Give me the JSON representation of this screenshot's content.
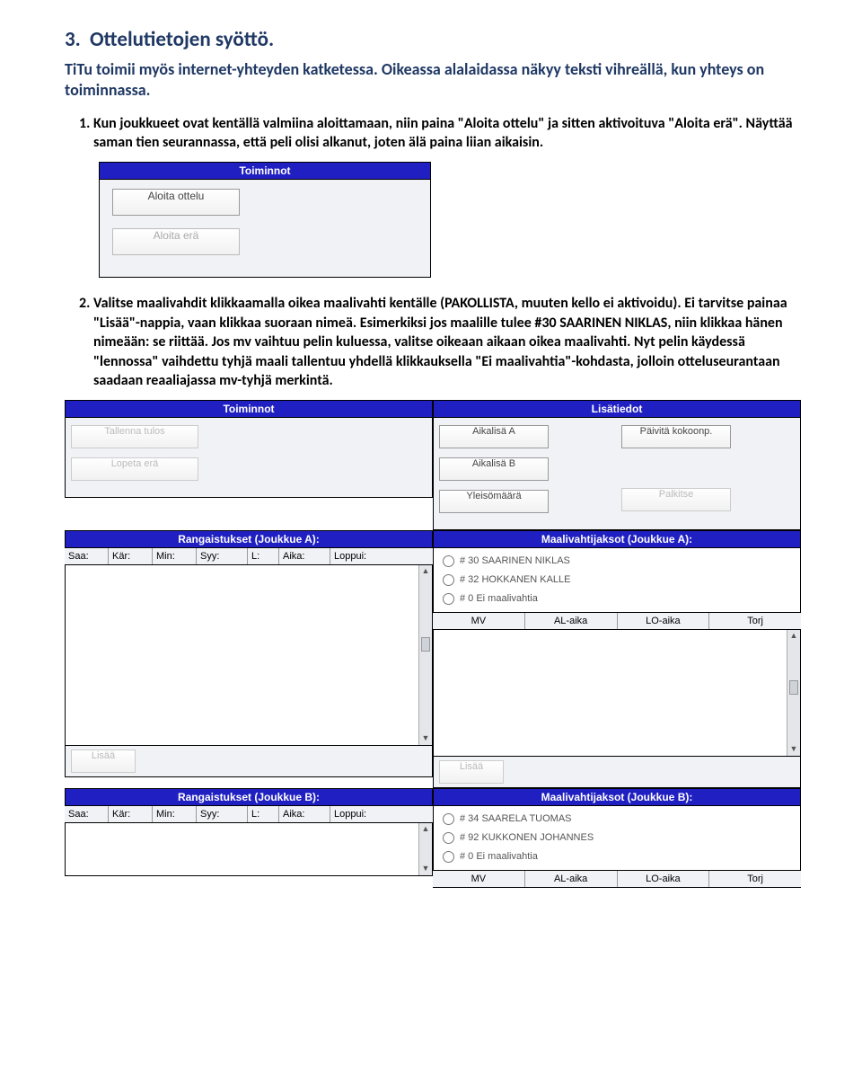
{
  "doc": {
    "heading_num": "3.",
    "heading_text": "Ottelutietojen syöttö.",
    "intro": "TiTu toimii myös internet-yhteyden katketessa. Oikeassa alalaidassa näkyy teksti vihreällä, kun yhteys on toiminnassa.",
    "item1": "Kun joukkueet ovat kentällä valmiina aloittamaan, niin paina \"Aloita ottelu\" ja sitten aktivoituva \"Aloita erä\". Näyttää saman tien seurannassa, että peli olisi alkanut, joten älä paina liian aikaisin.",
    "item2": "Valitse maalivahdit klikkaamalla oikea maalivahti kentälle (PAKOLLISTA, muuten kello ei aktivoidu). Ei tarvitse painaa \"Lisää\"-nappia, vaan klikkaa suoraan nimeä. Esimerkiksi jos maalille tulee #30 SAARINEN NIKLAS, niin klikkaa hänen nimeään: se riittää. Jos mv vaihtuu pelin kuluessa, valitse oikeaan aikaan oikea maalivahti. Nyt pelin käydessä \"lennossa\" vaihdettu tyhjä maali tallentuu yhdellä klikkauksella \"Ei maalivahtia\"-kohdasta, jolloin otteluseurantaan saadaan reaaliajassa mv-tyhjä merkintä."
  },
  "shot1": {
    "title": "Toiminnot",
    "btn1": "Aloita ottelu",
    "btn2": "Aloita erä"
  },
  "shot2": {
    "toiminnot": "Toiminnot",
    "lisatiedot": "Lisätiedot",
    "tallenna": "Tallenna tulos",
    "lopeta": "Lopeta erä",
    "aikaA": "Aikalisä A",
    "aikaB": "Aikalisä B",
    "yleiso": "Yleisömäärä",
    "paivita": "Päivitä kokoonp.",
    "palkitse": "Palkitse",
    "rangA": "Rangaistukset (Joukkue A):",
    "rangB": "Rangaistukset (Joukkue B):",
    "mvA": "Maalivahtijaksot (Joukkue A):",
    "mvB": "Maalivahtijaksot (Joukkue B):",
    "cols": {
      "saa": "Saa:",
      "kar": "Kär:",
      "min": "Min:",
      "syy": "Syy:",
      "l": "L:",
      "aika": "Aika:",
      "loppui": "Loppui:"
    },
    "mvcols": {
      "mv": "MV",
      "al": "AL-aika",
      "lo": "LO-aika",
      "torj": "Torj"
    },
    "gkA": [
      "# 30 SAARINEN NIKLAS",
      "# 32 HOKKANEN KALLE",
      "# 0 Ei maalivahtia"
    ],
    "gkB": [
      "# 34 SAARELA TUOMAS",
      "# 92 KUKKONEN JOHANNES",
      "# 0 Ei maalivahtia"
    ],
    "lisaa": "Lisää"
  }
}
